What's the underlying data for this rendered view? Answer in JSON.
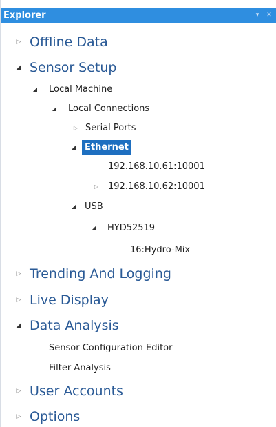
{
  "panel": {
    "title": "Explorer",
    "pin_glyph": "▾",
    "close_glyph": "✕"
  },
  "tree": {
    "offline_data": "Offline Data",
    "sensor_setup": "Sensor Setup",
    "local_machine": "Local Machine",
    "local_connections": "Local Connections",
    "serial_ports": "Serial Ports",
    "ethernet": "Ethernet",
    "ip1": "192.168.10.61:10001",
    "ip2": "192.168.10.62:10001",
    "usb": "USB",
    "hyd": "HYD52519",
    "hydro_mix": "16:Hydro-Mix",
    "trending": "Trending And Logging",
    "live_display": "Live Display",
    "data_analysis": "Data Analysis",
    "sensor_config_editor": "Sensor Configuration Editor",
    "filter_analysis": "Filter Analysis",
    "user_accounts": "User Accounts",
    "options": "Options"
  },
  "icons": {
    "collapsed": "▷",
    "expanded": "◢"
  },
  "colors": {
    "titlebar": "#2f8ee0",
    "top_label": "#2a5a96",
    "selection": "#1e6fc0"
  }
}
